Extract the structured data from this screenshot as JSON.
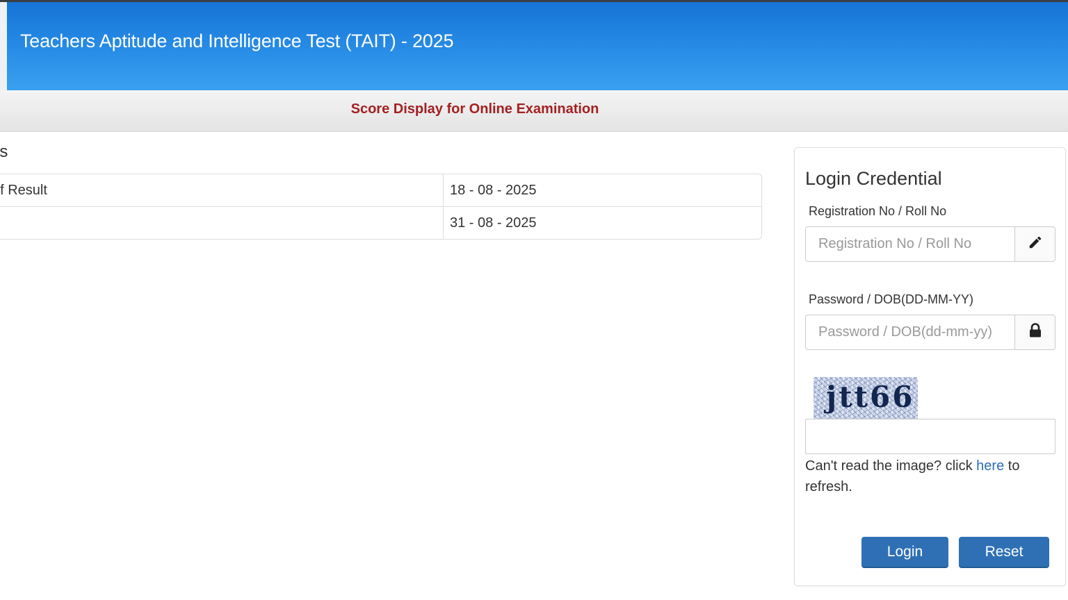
{
  "header": {
    "title": "Teachers Aptitude and Intelligence Test (TAIT) - 2025"
  },
  "subheader": {
    "text": "Score Display for Online Examination"
  },
  "dates_section": {
    "heading_visible": "es",
    "rows": [
      {
        "label_visible": "of Result",
        "value": "18 - 08 - 2025"
      },
      {
        "label_visible": "",
        "value": "31 - 08 - 2025"
      }
    ]
  },
  "login": {
    "title": "Login Credential",
    "registration_label": "Registration No / Roll No",
    "registration_placeholder": "Registration No / Roll No",
    "registration_icon": "pencil-icon",
    "password_label": "Password / DOB(DD-MM-YY)",
    "password_placeholder": "Password / DOB(dd-mm-yy)",
    "password_icon": "lock-icon",
    "captcha_text": "jtt66",
    "captcha_input_value": "",
    "refresh_prefix": "Can't read the image? click ",
    "refresh_link": "here",
    "refresh_suffix": " to refresh.",
    "login_button": "Login",
    "reset_button": "Reset"
  },
  "colors": {
    "header_blue": "#2a8fe8",
    "subheader_text": "#a32121",
    "button_blue": "#2f70b5",
    "link_blue": "#2a6db8"
  }
}
